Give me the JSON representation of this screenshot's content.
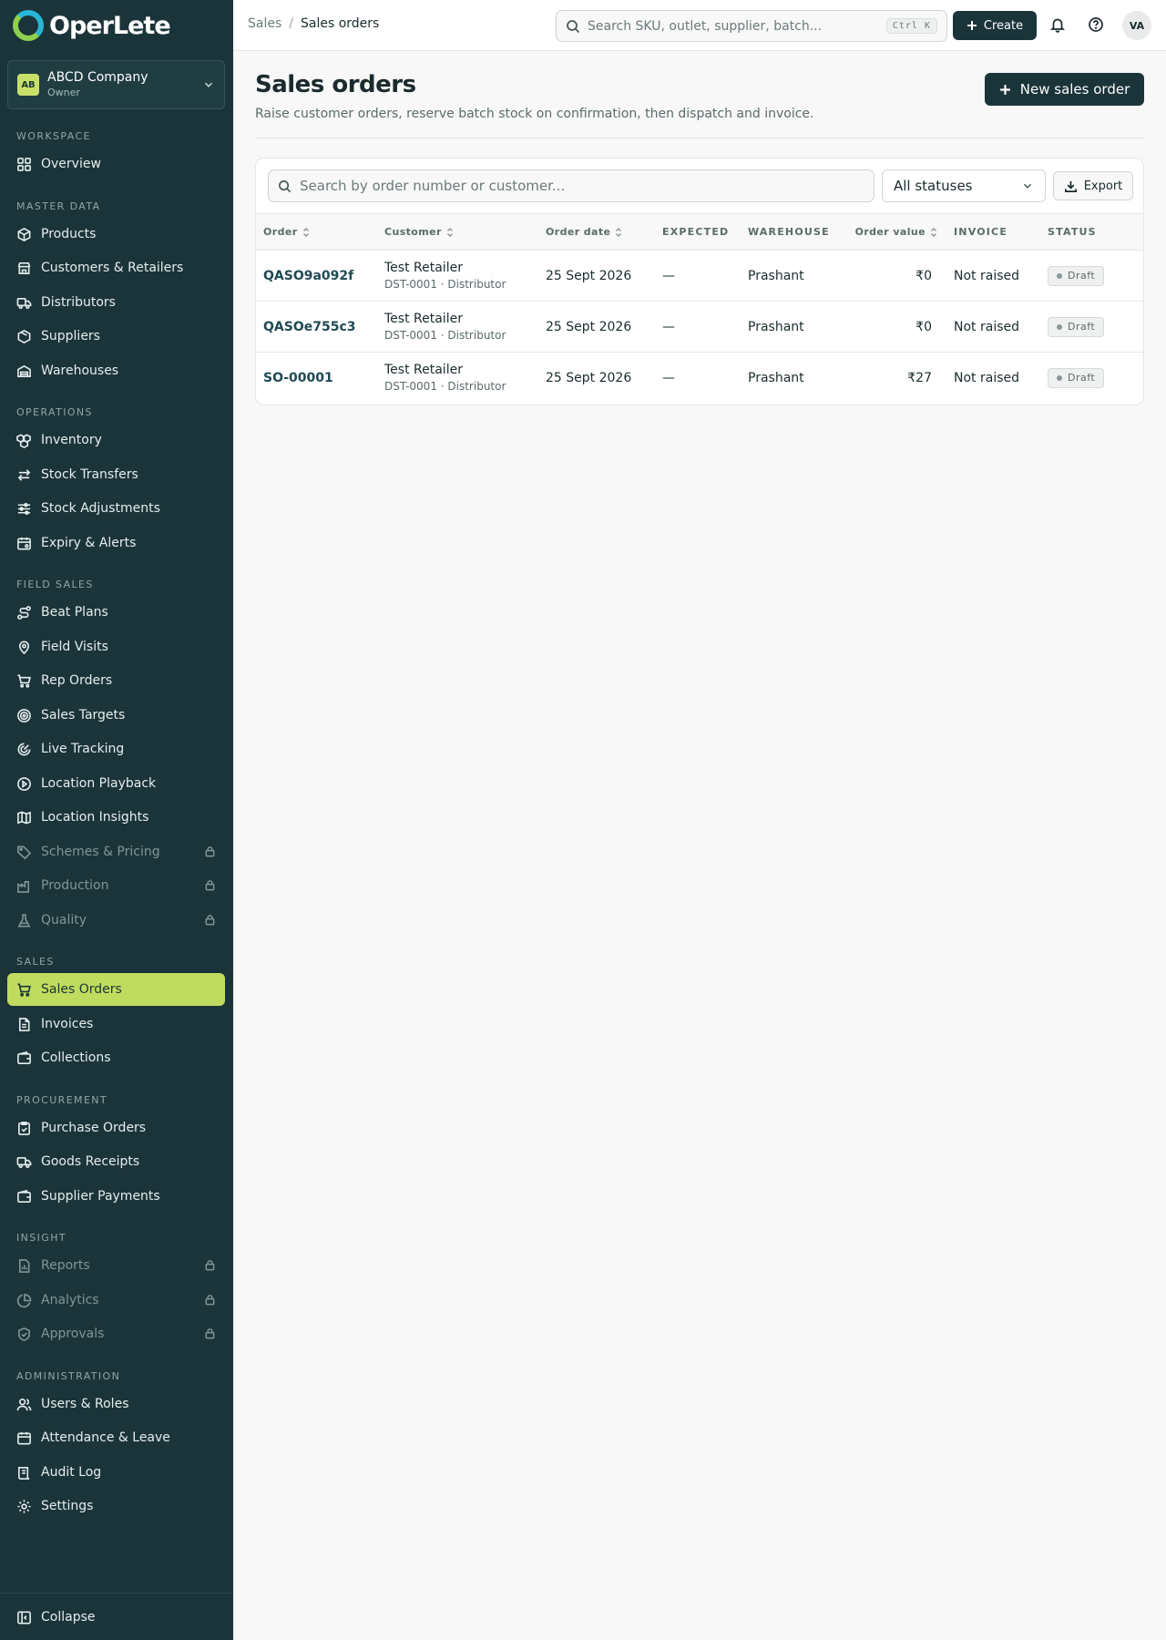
{
  "app": {
    "logo_text": "OperLete"
  },
  "company": {
    "initials": "AB",
    "name": "ABCD Company",
    "role": "Owner"
  },
  "sidebar": {
    "sections": [
      {
        "label": "WORKSPACE",
        "items": [
          {
            "label": "Overview",
            "icon": "grid-icon"
          }
        ]
      },
      {
        "label": "MASTER DATA",
        "items": [
          {
            "label": "Products",
            "icon": "box-icon"
          },
          {
            "label": "Customers & Retailers",
            "icon": "store-icon"
          },
          {
            "label": "Distributors",
            "icon": "truck-icon"
          },
          {
            "label": "Suppliers",
            "icon": "package-icon"
          },
          {
            "label": "Warehouses",
            "icon": "warehouse-icon"
          }
        ]
      },
      {
        "label": "OPERATIONS",
        "items": [
          {
            "label": "Inventory",
            "icon": "boxes-icon"
          },
          {
            "label": "Stock Transfers",
            "icon": "arrows-swap-icon"
          },
          {
            "label": "Stock Adjustments",
            "icon": "sliders-icon"
          },
          {
            "label": "Expiry & Alerts",
            "icon": "calendar-alert-icon"
          }
        ]
      },
      {
        "label": "FIELD SALES",
        "items": [
          {
            "label": "Beat Plans",
            "icon": "route-icon"
          },
          {
            "label": "Field Visits",
            "icon": "map-pin-icon"
          },
          {
            "label": "Rep Orders",
            "icon": "cart-icon"
          },
          {
            "label": "Sales Targets",
            "icon": "target-icon"
          },
          {
            "label": "Live Tracking",
            "icon": "radar-icon"
          },
          {
            "label": "Location Playback",
            "icon": "play-circle-icon"
          },
          {
            "label": "Location Insights",
            "icon": "map-icon"
          },
          {
            "label": "Schemes & Pricing",
            "icon": "tag-icon",
            "locked": true
          },
          {
            "label": "Production",
            "icon": "factory-icon",
            "locked": true
          },
          {
            "label": "Quality",
            "icon": "flask-icon",
            "locked": true
          }
        ]
      },
      {
        "label": "SALES",
        "items": [
          {
            "label": "Sales Orders",
            "icon": "cart-icon",
            "active": true
          },
          {
            "label": "Invoices",
            "icon": "file-text-icon"
          },
          {
            "label": "Collections",
            "icon": "wallet-icon"
          }
        ]
      },
      {
        "label": "PROCUREMENT",
        "items": [
          {
            "label": "Purchase Orders",
            "icon": "clipboard-check-icon"
          },
          {
            "label": "Goods Receipts",
            "icon": "truck-icon"
          },
          {
            "label": "Supplier Payments",
            "icon": "wallet-icon"
          }
        ]
      },
      {
        "label": "INSIGHT",
        "items": [
          {
            "label": "Reports",
            "icon": "file-chart-icon",
            "locked": true
          },
          {
            "label": "Analytics",
            "icon": "pie-chart-icon",
            "locked": true
          },
          {
            "label": "Approvals",
            "icon": "shield-check-icon",
            "locked": true
          }
        ]
      },
      {
        "label": "ADMINISTRATION",
        "items": [
          {
            "label": "Users & Roles",
            "icon": "users-icon"
          },
          {
            "label": "Attendance & Leave",
            "icon": "calendar-icon"
          },
          {
            "label": "Audit Log",
            "icon": "scroll-icon"
          },
          {
            "label": "Settings",
            "icon": "gear-icon"
          }
        ]
      }
    ],
    "collapse_label": "Collapse"
  },
  "topbar": {
    "breadcrumb_parent": "Sales",
    "breadcrumb_sep": "/",
    "breadcrumb_current": "Sales orders",
    "search_placeholder": "Search SKU, outlet, supplier, batch...",
    "search_shortcut": "Ctrl K",
    "create_label": "Create",
    "user_initials": "VA"
  },
  "page": {
    "title": "Sales orders",
    "subtitle": "Raise customer orders, reserve batch stock on confirmation, then dispatch and invoice.",
    "new_button": "New sales order"
  },
  "filters": {
    "search_placeholder": "Search by order number or customer...",
    "status_value": "All statuses",
    "export_label": "Export"
  },
  "table": {
    "columns": [
      "Order",
      "Customer",
      "Order date",
      "EXPECTED",
      "WAREHOUSE",
      "Order value",
      "INVOICE",
      "STATUS"
    ],
    "rows": [
      {
        "order": "QASO9a092f",
        "customer": "Test Retailer",
        "customer_sub": "DST-0001 · Distributor",
        "date": "25 Sept 2026",
        "expected": "—",
        "warehouse": "Prashant",
        "value": "₹0",
        "invoice": "Not raised",
        "status": "Draft"
      },
      {
        "order": "QASOe755c3",
        "customer": "Test Retailer",
        "customer_sub": "DST-0001 · Distributor",
        "date": "25 Sept 2026",
        "expected": "—",
        "warehouse": "Prashant",
        "value": "₹0",
        "invoice": "Not raised",
        "status": "Draft"
      },
      {
        "order": "SO-00001",
        "customer": "Test Retailer",
        "customer_sub": "DST-0001 · Distributor",
        "date": "25 Sept 2026",
        "expected": "—",
        "warehouse": "Prashant",
        "value": "₹27",
        "invoice": "Not raised",
        "status": "Draft"
      }
    ]
  },
  "colors": {
    "sidebar_bg": "#1b3439",
    "accent": "#bfdc5e",
    "primary": "#1b3439"
  }
}
